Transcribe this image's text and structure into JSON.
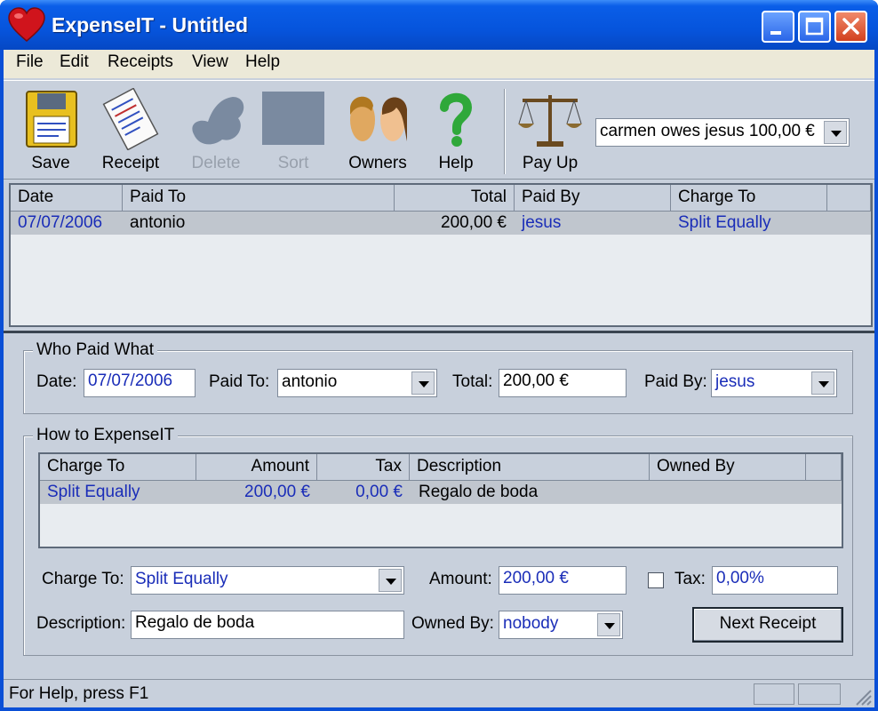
{
  "window": {
    "title": "ExpenseIT - Untitled"
  },
  "menu": [
    "File",
    "Edit",
    "Receipts",
    "View",
    "Help"
  ],
  "toolbar": {
    "save": "Save",
    "receipt": "Receipt",
    "delete": "Delete",
    "sort": "Sort",
    "owners": "Owners",
    "help": "Help",
    "payup": "Pay Up",
    "balance": "carmen owes jesus 100,00 €"
  },
  "expenses": {
    "columns": [
      "Date",
      "Paid To",
      "Total",
      "Paid By",
      "Charge To"
    ],
    "rows": [
      {
        "date": "07/07/2006",
        "paid_to": "antonio",
        "total": "200,00 €",
        "paid_by": "jesus",
        "charge_to": "Split Equally"
      }
    ]
  },
  "who_paid": {
    "title": "Who Paid What",
    "date_label": "Date:",
    "date": "07/07/2006",
    "paid_to_label": "Paid To:",
    "paid_to": "antonio",
    "total_label": "Total:",
    "total": "200,00 €",
    "paid_by_label": "Paid By:",
    "paid_by": "jesus"
  },
  "how_to": {
    "title": "How to ExpenseIT",
    "columns": [
      "Charge To",
      "Amount",
      "Tax",
      "Description",
      "Owned By"
    ],
    "rows": [
      {
        "charge_to": "Split Equally",
        "amount": "200,00 €",
        "tax": "0,00 €",
        "description": "Regalo de boda",
        "owned_by": ""
      }
    ],
    "charge_to_label": "Charge To:",
    "charge_to": "Split Equally",
    "amount_label": "Amount:",
    "amount": "200,00 €",
    "tax_label": "Tax:",
    "tax": "0,00%",
    "tax_checked": false,
    "description_label": "Description:",
    "description": "Regalo de boda",
    "owned_by_label": "Owned By:",
    "owned_by": "nobody",
    "next_button": "Next Receipt"
  },
  "status": {
    "text": "For Help, press F1"
  }
}
